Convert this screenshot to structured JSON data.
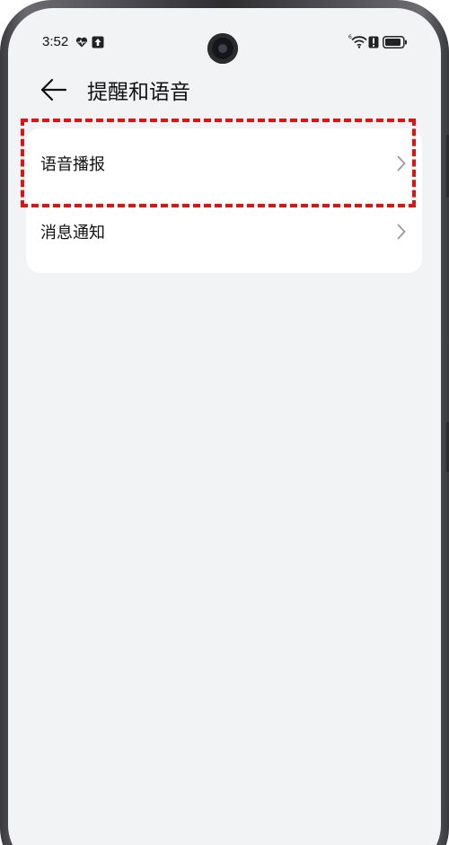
{
  "status_bar": {
    "time": "3:52",
    "left_icons": [
      "heart-icon",
      "upload-icon"
    ],
    "right_icons": [
      "wifi-icon",
      "alert-icon",
      "battery-icon"
    ]
  },
  "header": {
    "title": "提醒和语音",
    "back_icon": "arrow-left-icon"
  },
  "settings_list": {
    "items": [
      {
        "label": "语音播报",
        "icon": "chevron-right-icon",
        "highlighted": true
      },
      {
        "label": "消息通知",
        "icon": "chevron-right-icon",
        "highlighted": false
      }
    ]
  },
  "colors": {
    "background": "#f1f3f5",
    "card": "#ffffff",
    "highlight_border": "#e41111",
    "text": "#111111",
    "chevron": "#9a9a9a"
  }
}
